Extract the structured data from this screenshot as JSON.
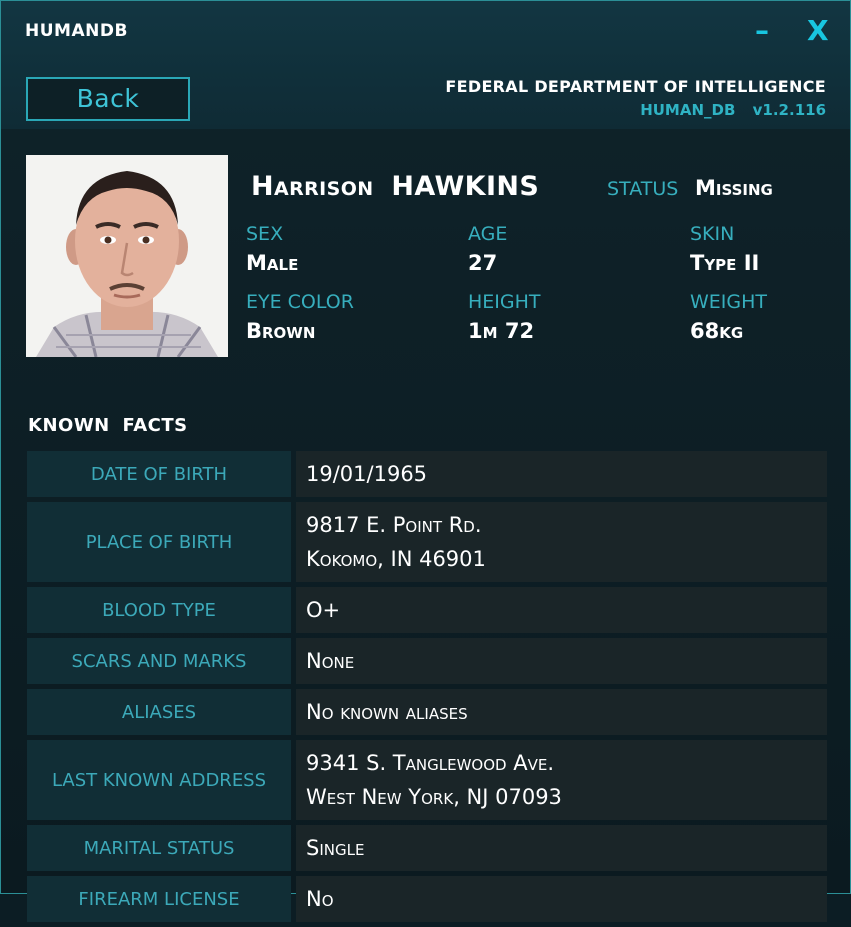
{
  "window": {
    "title": "HUMANDB",
    "minimize_icon": "–",
    "close_icon": "X",
    "accent": "#18c6e0"
  },
  "header": {
    "back_label": "Back",
    "agency": "FEDERAL DEPARTMENT OF INTELLIGENCE",
    "db_name": "HUMAN_DB",
    "version": "v1.2.116"
  },
  "profile": {
    "first_name": "Harrison",
    "last_name": "HAWKINS",
    "status_label": "STATUS",
    "status_value": "Missing",
    "attributes": [
      {
        "label": "SEX",
        "value": "Male"
      },
      {
        "label": "AGE",
        "value": "27"
      },
      {
        "label": "SKIN",
        "value": "Type II"
      },
      {
        "label": "EYE COLOR",
        "value": "Brown"
      },
      {
        "label": "HEIGHT",
        "value": "1m 72"
      },
      {
        "label": "WEIGHT",
        "value": "68kg"
      }
    ]
  },
  "facts": {
    "title": "KNOWN FACTS",
    "rows": [
      {
        "label": "DATE OF BIRTH",
        "lines": [
          "19/01/1965"
        ]
      },
      {
        "label": "PLACE OF BIRTH",
        "lines": [
          "9817 E. Point Rd.",
          "Kokomo, IN 46901"
        ]
      },
      {
        "label": "BLOOD TYPE",
        "lines": [
          "O+"
        ]
      },
      {
        "label": "SCARS AND MARKS",
        "lines": [
          "None"
        ]
      },
      {
        "label": "ALIASES",
        "lines": [
          "No known aliases"
        ]
      },
      {
        "label": "LAST KNOWN ADDRESS",
        "lines": [
          "9341 S. Tanglewood Ave.",
          "West New York, NJ 07093"
        ]
      },
      {
        "label": "MARITAL STATUS",
        "lines": [
          "Single"
        ]
      },
      {
        "label": "FIREARM LICENSE",
        "lines": [
          "No"
        ]
      }
    ]
  }
}
